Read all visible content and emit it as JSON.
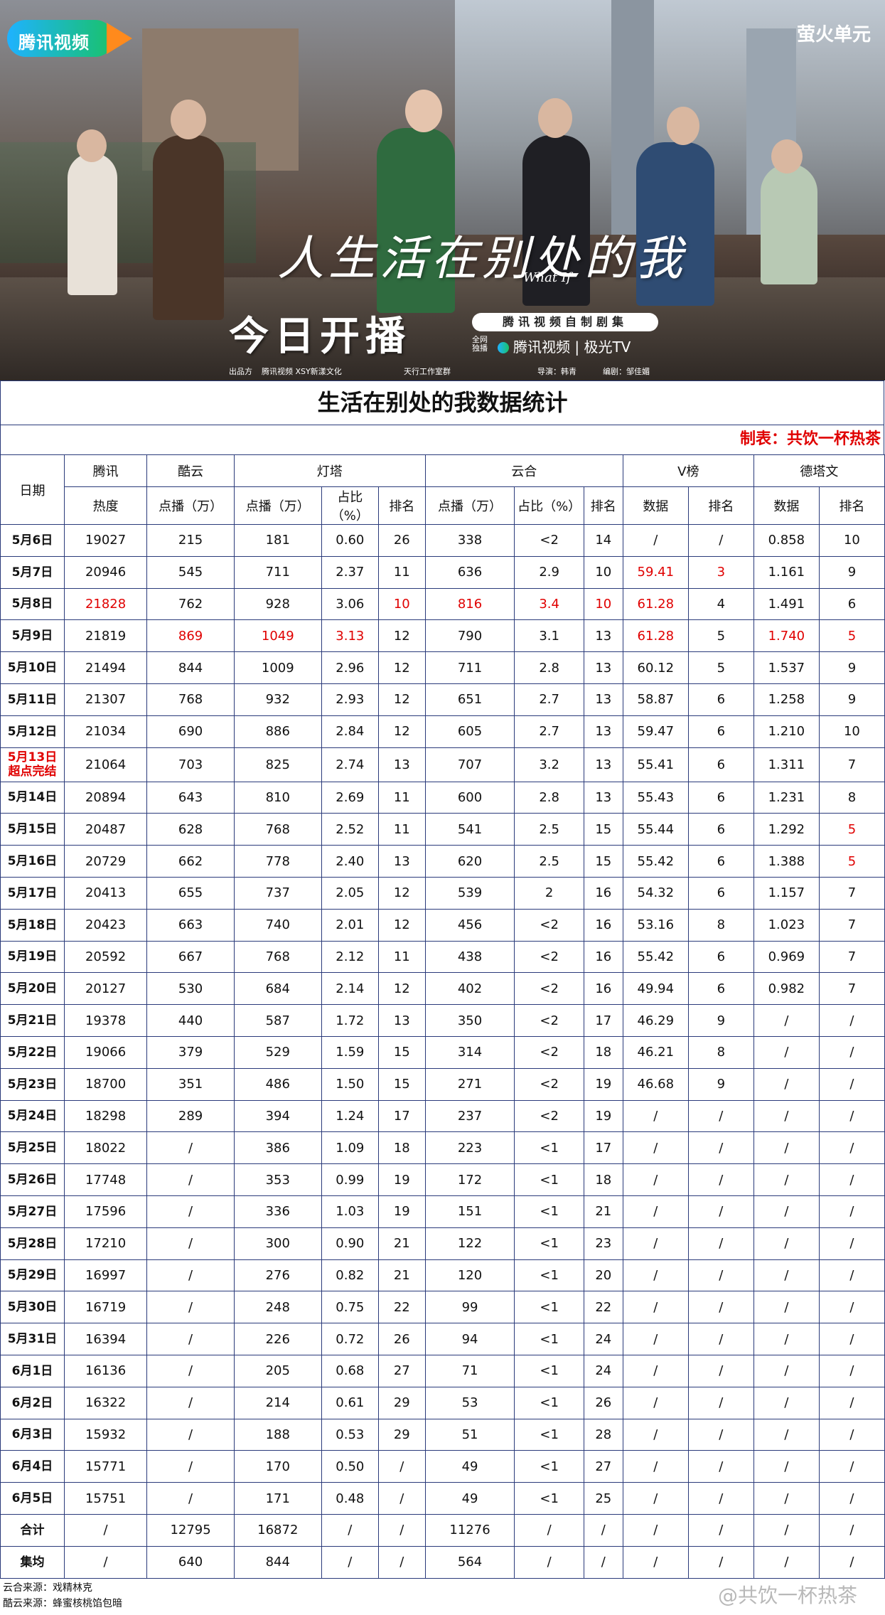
{
  "poster": {
    "brand_logo": "腾讯视频",
    "corner_brand": "萤火单元",
    "drama_title_calligraphy": "人生活在别处的我",
    "english_title": "What If",
    "tagline": "今日开播",
    "selfmade_label": "腾讯视频自制剧集",
    "allnet_label": "全网独播",
    "platforms": "腾讯视频 | 极光TV",
    "producer_label": "出品方",
    "producer_value": "腾讯视频  XSY新漾文化",
    "studio": "天行工作室群",
    "director": "导演：韩青",
    "writer": "编剧：邹佳媚"
  },
  "title": "生活在别处的我数据统计",
  "maker": "制表：共饮一杯热茶",
  "table": {
    "group_headers": [
      "日期",
      "腾讯",
      "酷云",
      "灯塔",
      "云合",
      "V榜",
      "德塔文"
    ],
    "sub_headers": [
      "热度",
      "点播（万）",
      "点播（万）",
      "占比（%）",
      "排名",
      "点播（万）",
      "占比（%）",
      "排名",
      "数据",
      "排名",
      "数据",
      "排名"
    ],
    "rows": [
      [
        "5月6日",
        "19027",
        "215",
        "181",
        "0.60",
        "26",
        "338",
        "<2",
        "14",
        "/",
        "/",
        "0.858",
        "10"
      ],
      [
        "5月7日",
        "20946",
        "545",
        "711",
        "2.37",
        "11",
        "636",
        "2.9",
        "10",
        "59.41",
        "3",
        "1.161",
        "9"
      ],
      [
        "5月8日",
        "21828",
        "762",
        "928",
        "3.06",
        "10",
        "816",
        "3.4",
        "10",
        "61.28",
        "4",
        "1.491",
        "6"
      ],
      [
        "5月9日",
        "21819",
        "869",
        "1049",
        "3.13",
        "12",
        "790",
        "3.1",
        "13",
        "61.28",
        "5",
        "1.740",
        "5"
      ],
      [
        "5月10日",
        "21494",
        "844",
        "1009",
        "2.96",
        "12",
        "711",
        "2.8",
        "13",
        "60.12",
        "5",
        "1.537",
        "9"
      ],
      [
        "5月11日",
        "21307",
        "768",
        "932",
        "2.93",
        "12",
        "651",
        "2.7",
        "13",
        "58.87",
        "6",
        "1.258",
        "9"
      ],
      [
        "5月12日",
        "21034",
        "690",
        "886",
        "2.84",
        "12",
        "605",
        "2.7",
        "13",
        "59.47",
        "6",
        "1.210",
        "10"
      ],
      [
        "5月13日\n超点完结",
        "21064",
        "703",
        "825",
        "2.74",
        "13",
        "707",
        "3.2",
        "13",
        "55.41",
        "6",
        "1.311",
        "7"
      ],
      [
        "5月14日",
        "20894",
        "643",
        "810",
        "2.69",
        "11",
        "600",
        "2.8",
        "13",
        "55.43",
        "6",
        "1.231",
        "8"
      ],
      [
        "5月15日",
        "20487",
        "628",
        "768",
        "2.52",
        "11",
        "541",
        "2.5",
        "15",
        "55.44",
        "6",
        "1.292",
        "5"
      ],
      [
        "5月16日",
        "20729",
        "662",
        "778",
        "2.40",
        "13",
        "620",
        "2.5",
        "15",
        "55.42",
        "6",
        "1.388",
        "5"
      ],
      [
        "5月17日",
        "20413",
        "655",
        "737",
        "2.05",
        "12",
        "539",
        "2",
        "16",
        "54.32",
        "6",
        "1.157",
        "7"
      ],
      [
        "5月18日",
        "20423",
        "663",
        "740",
        "2.01",
        "12",
        "456",
        "<2",
        "16",
        "53.16",
        "8",
        "1.023",
        "7"
      ],
      [
        "5月19日",
        "20592",
        "667",
        "768",
        "2.12",
        "11",
        "438",
        "<2",
        "16",
        "55.42",
        "6",
        "0.969",
        "7"
      ],
      [
        "5月20日",
        "20127",
        "530",
        "684",
        "2.14",
        "12",
        "402",
        "<2",
        "16",
        "49.94",
        "6",
        "0.982",
        "7"
      ],
      [
        "5月21日",
        "19378",
        "440",
        "587",
        "1.72",
        "13",
        "350",
        "<2",
        "17",
        "46.29",
        "9",
        "/",
        "/"
      ],
      [
        "5月22日",
        "19066",
        "379",
        "529",
        "1.59",
        "15",
        "314",
        "<2",
        "18",
        "46.21",
        "8",
        "/",
        "/"
      ],
      [
        "5月23日",
        "18700",
        "351",
        "486",
        "1.50",
        "15",
        "271",
        "<2",
        "19",
        "46.68",
        "9",
        "/",
        "/"
      ],
      [
        "5月24日",
        "18298",
        "289",
        "394",
        "1.24",
        "17",
        "237",
        "<2",
        "19",
        "/",
        "/",
        "/",
        "/"
      ],
      [
        "5月25日",
        "18022",
        "/",
        "386",
        "1.09",
        "18",
        "223",
        "<1",
        "17",
        "/",
        "/",
        "/",
        "/"
      ],
      [
        "5月26日",
        "17748",
        "/",
        "353",
        "0.99",
        "19",
        "172",
        "<1",
        "18",
        "/",
        "/",
        "/",
        "/"
      ],
      [
        "5月27日",
        "17596",
        "/",
        "336",
        "1.03",
        "19",
        "151",
        "<1",
        "21",
        "/",
        "/",
        "/",
        "/"
      ],
      [
        "5月28日",
        "17210",
        "/",
        "300",
        "0.90",
        "21",
        "122",
        "<1",
        "23",
        "/",
        "/",
        "/",
        "/"
      ],
      [
        "5月29日",
        "16997",
        "/",
        "276",
        "0.82",
        "21",
        "120",
        "<1",
        "20",
        "/",
        "/",
        "/",
        "/"
      ],
      [
        "5月30日",
        "16719",
        "/",
        "248",
        "0.75",
        "22",
        "99",
        "<1",
        "22",
        "/",
        "/",
        "/",
        "/"
      ],
      [
        "5月31日",
        "16394",
        "/",
        "226",
        "0.72",
        "26",
        "94",
        "<1",
        "24",
        "/",
        "/",
        "/",
        "/"
      ],
      [
        "6月1日",
        "16136",
        "/",
        "205",
        "0.68",
        "27",
        "71",
        "<1",
        "24",
        "/",
        "/",
        "/",
        "/"
      ],
      [
        "6月2日",
        "16322",
        "/",
        "214",
        "0.61",
        "29",
        "53",
        "<1",
        "26",
        "/",
        "/",
        "/",
        "/"
      ],
      [
        "6月3日",
        "15932",
        "/",
        "188",
        "0.53",
        "29",
        "51",
        "<1",
        "28",
        "/",
        "/",
        "/",
        "/"
      ],
      [
        "6月4日",
        "15771",
        "/",
        "170",
        "0.50",
        "/",
        "49",
        "<1",
        "27",
        "/",
        "/",
        "/",
        "/"
      ],
      [
        "6月5日",
        "15751",
        "/",
        "171",
        "0.48",
        "/",
        "49",
        "<1",
        "25",
        "/",
        "/",
        "/",
        "/"
      ],
      [
        "合计",
        "/",
        "12795",
        "16872",
        "/",
        "/",
        "11276",
        "/",
        "/",
        "/",
        "/",
        "/",
        "/"
      ],
      [
        "集均",
        "/",
        "640",
        "844",
        "/",
        "/",
        "564",
        "/",
        "/",
        "/",
        "/",
        "/",
        "/"
      ]
    ],
    "highlight_color": "#e00000",
    "highlights": [
      [
        1,
        9,
        "r"
      ],
      [
        1,
        10,
        "r"
      ],
      [
        2,
        1,
        "r"
      ],
      [
        2,
        5,
        "r"
      ],
      [
        2,
        6,
        "r"
      ],
      [
        2,
        7,
        "r"
      ],
      [
        2,
        8,
        "r"
      ],
      [
        2,
        9,
        "r"
      ],
      [
        3,
        2,
        "r"
      ],
      [
        3,
        3,
        "r"
      ],
      [
        3,
        4,
        "r"
      ],
      [
        3,
        9,
        "r"
      ],
      [
        3,
        11,
        "r"
      ],
      [
        3,
        12,
        "r"
      ],
      [
        7,
        0,
        "r"
      ],
      [
        9,
        12,
        "r"
      ],
      [
        10,
        12,
        "r"
      ]
    ]
  },
  "sources": [
    "云合来源：戏精林克",
    "酷云来源：蜂蜜核桃馅包暗"
  ],
  "watermark": "@共饮一杯热茶"
}
